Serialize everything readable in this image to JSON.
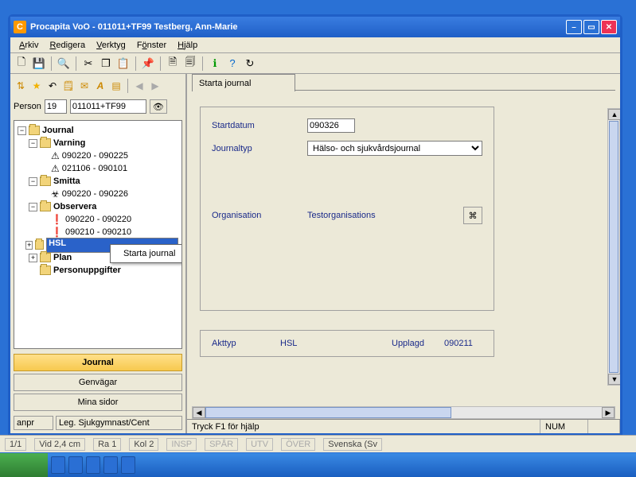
{
  "window": {
    "iconLetter": "C",
    "title": "Procapita VoO - 011011+TF99 Testberg, Ann-Marie"
  },
  "menu": {
    "arkiv": "Arkiv",
    "redigera": "Redigera",
    "verktyg": "Verktyg",
    "fonster": "Fönster",
    "hjalp": "Hjälp"
  },
  "person": {
    "label": "Person",
    "num": "19",
    "id": "011011+TF99"
  },
  "tree": {
    "root": "Journal",
    "varning": "Varning",
    "v1": "090220 - 090225",
    "v2": "021106 - 090101",
    "smitta": "Smitta",
    "s1": "090220 - 090226",
    "observera": "Observera",
    "o1": "090220 - 090220",
    "o2": "090210 - 090210",
    "hsl": "HSL",
    "plan": "Plan",
    "personuppgifter": "Personuppgifter"
  },
  "context": {
    "startaJournal": "Starta journal"
  },
  "nav": {
    "journal": "Journal",
    "genvagar": "Genvägar",
    "minasidor": "Mina sidor"
  },
  "status": {
    "user": "anpr",
    "role": "Leg. Sjukgymnast/Cent"
  },
  "tab": {
    "label": "Starta journal"
  },
  "form": {
    "startdatumLabel": "Startdatum",
    "startdatum": "090326",
    "journaltypLabel": "Journaltyp",
    "journaltyp": "Hälso- och sjukvårdsjournal",
    "organisationLabel": "Organisation",
    "organisation": "Testorganisations"
  },
  "info": {
    "akttypLabel": "Akttyp",
    "akttyp": "HSL",
    "upplagdLabel": "Upplagd",
    "upplagd": "090211"
  },
  "winstatus": {
    "help": "Tryck F1 för hjälp",
    "num": "NUM"
  },
  "back": {
    "page": "1/1",
    "vid": "Vid 2,4 cm",
    "ra": "Ra 1",
    "kol": "Kol 2",
    "insp": "INSP",
    "spar": "SPÅR",
    "utv": "UTV",
    "over": "ÖVER",
    "lang": "Svenska (Sv"
  }
}
